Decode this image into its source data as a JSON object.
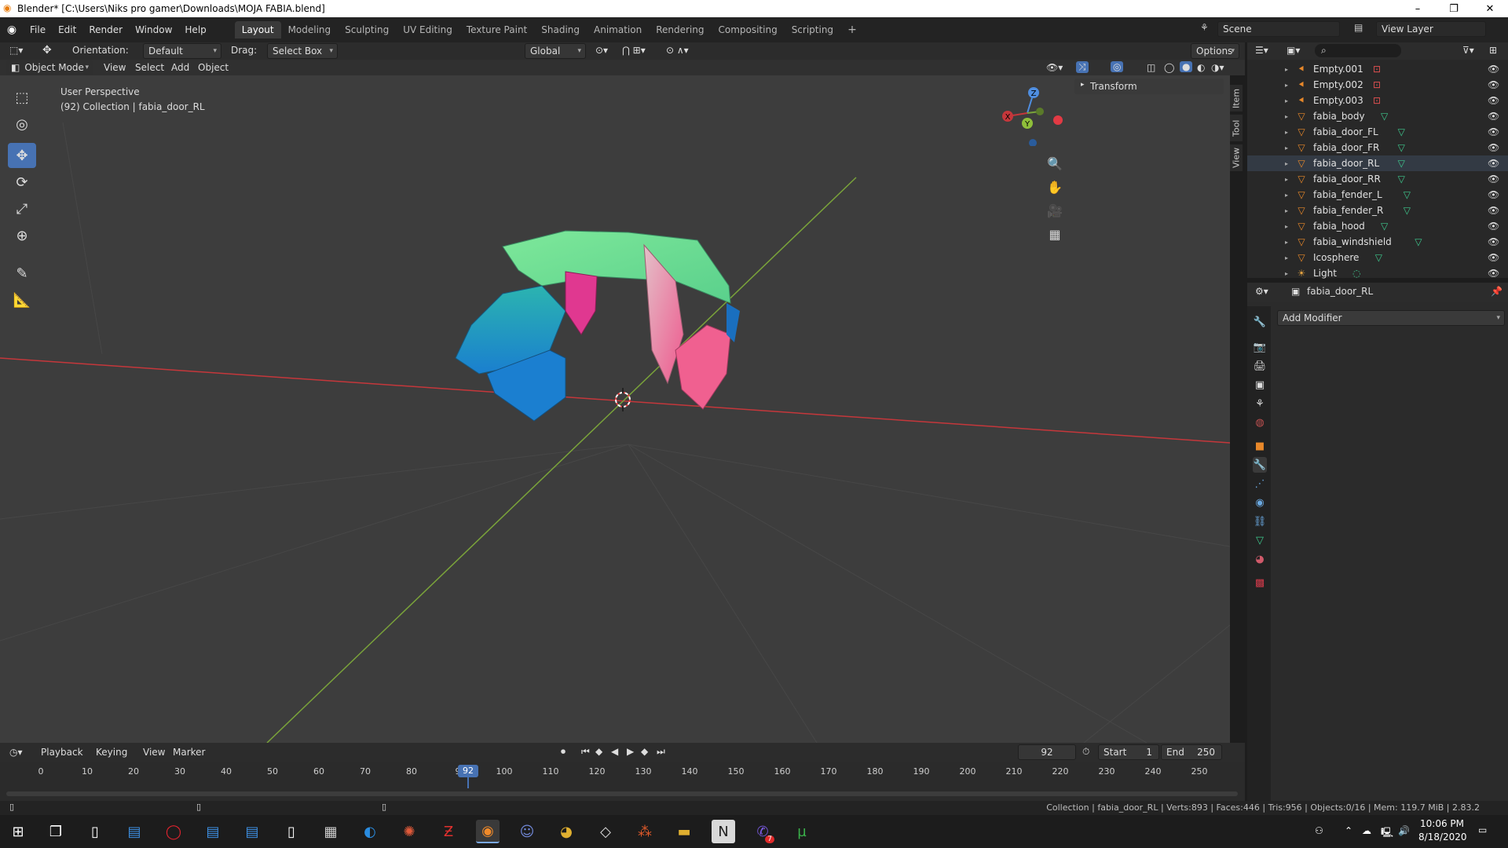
{
  "window": {
    "title": "Blender* [C:\\Users\\Niks pro gamer\\Downloads\\MOJA FABIA.blend]",
    "controls": [
      "–",
      "❐",
      "✕"
    ]
  },
  "topbar": {
    "menus": [
      "File",
      "Edit",
      "Render",
      "Window",
      "Help"
    ],
    "workspaces": [
      "Layout",
      "Modeling",
      "Sculpting",
      "UV Editing",
      "Texture Paint",
      "Shading",
      "Animation",
      "Rendering",
      "Compositing",
      "Scripting"
    ],
    "active_workspace": "Layout",
    "add_tab": "+",
    "scene": "Scene",
    "view_layer": "View Layer"
  },
  "tool_header": {
    "orientation_label": "Orientation:",
    "orientation_value": "Default",
    "drag_label": "Drag:",
    "drag_value": "Select Box",
    "transform_orientation": "Global",
    "options": "Options"
  },
  "viewport_header": {
    "mode": "Object Mode",
    "menus": [
      "View",
      "Select",
      "Add",
      "Object"
    ]
  },
  "viewport": {
    "perspective": "User Perspective",
    "collection_info": "(92) Collection | fabia_door_RL",
    "transform_panel": "Transform",
    "side_tabs": [
      "Item",
      "Tool",
      "View"
    ],
    "gizmo": {
      "x": "X",
      "y": "Y",
      "z": "Z"
    },
    "colors": {
      "x_axis": "#c5373b",
      "y_axis": "#7aa33a",
      "background": "#3d3d3d"
    }
  },
  "outliner": {
    "items": [
      {
        "name": "Empty.001",
        "type": "empty"
      },
      {
        "name": "Empty.002",
        "type": "empty"
      },
      {
        "name": "Empty.003",
        "type": "empty"
      },
      {
        "name": "fabia_body",
        "type": "mesh"
      },
      {
        "name": "fabia_door_FL",
        "type": "mesh"
      },
      {
        "name": "fabia_door_FR",
        "type": "mesh"
      },
      {
        "name": "fabia_door_RL",
        "type": "mesh",
        "selected": true
      },
      {
        "name": "fabia_door_RR",
        "type": "mesh"
      },
      {
        "name": "fabia_fender_L",
        "type": "mesh"
      },
      {
        "name": "fabia_fender_R",
        "type": "mesh"
      },
      {
        "name": "fabia_hood",
        "type": "mesh"
      },
      {
        "name": "fabia_windshield",
        "type": "mesh"
      },
      {
        "name": "Icosphere",
        "type": "mesh"
      },
      {
        "name": "Light",
        "type": "light"
      }
    ]
  },
  "properties": {
    "object_name": "fabia_door_RL",
    "add_modifier": "Add Modifier"
  },
  "timeline": {
    "menus": [
      "Playback",
      "Keying",
      "View",
      "Marker"
    ],
    "current_frame": "92",
    "start_label": "Start",
    "start": "1",
    "end_label": "End",
    "end": "250",
    "ticks": [
      "0",
      "10",
      "20",
      "30",
      "40",
      "50",
      "60",
      "70",
      "80",
      "9",
      "100",
      "110",
      "120",
      "130",
      "140",
      "150",
      "160",
      "170",
      "180",
      "190",
      "200",
      "210",
      "220",
      "230",
      "240",
      "250"
    ],
    "playhead_label": "92"
  },
  "status": {
    "stats": "Collection | fabia_door_RL | Verts:893 | Faces:446 | Tris:956 | Objects:0/16 | Mem: 119.7 MiB | 2.83.2"
  },
  "taskbar": {
    "time": "10:06 PM",
    "date": "8/18/2020",
    "badge": "7"
  }
}
